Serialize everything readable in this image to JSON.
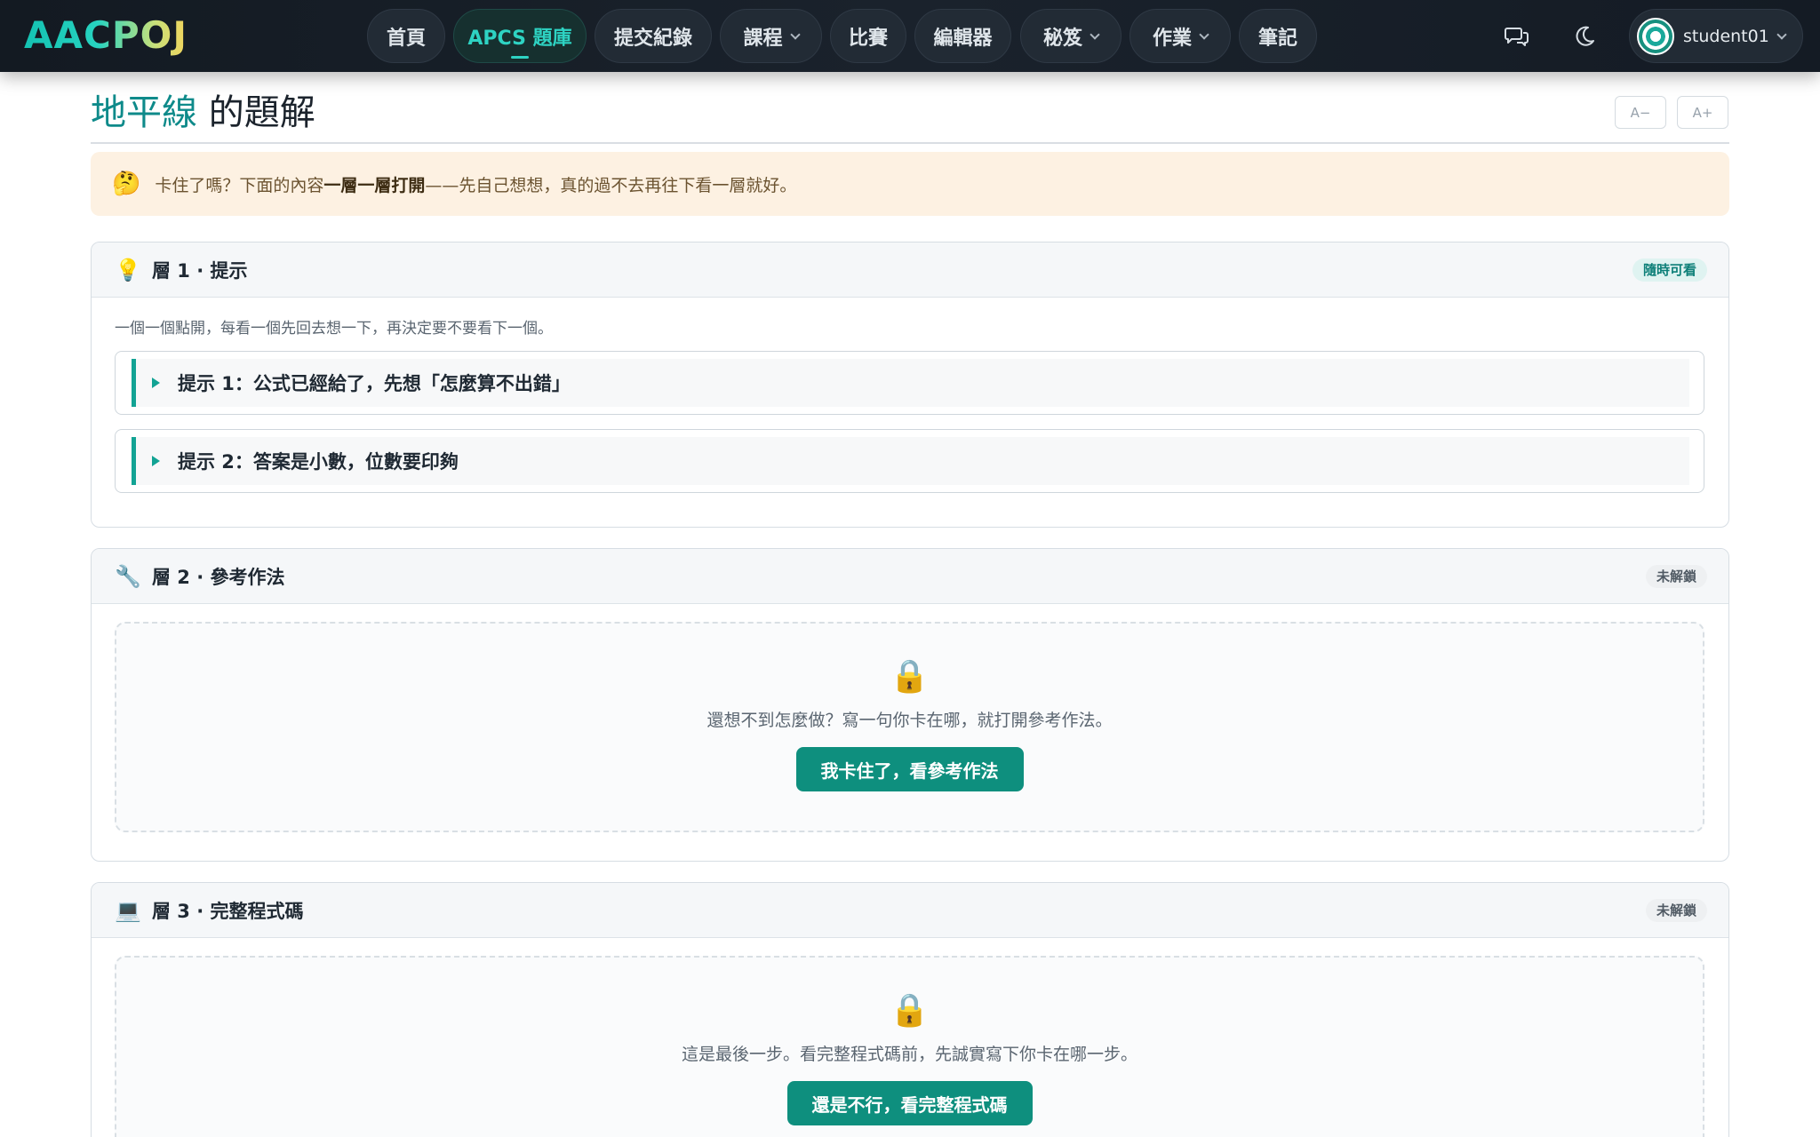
{
  "brand": {
    "logo_text": "AACPOJ"
  },
  "nav": {
    "items": [
      {
        "label": "首頁"
      },
      {
        "label": "APCS 題庫"
      },
      {
        "label": "提交紀錄"
      },
      {
        "label": "課程"
      },
      {
        "label": "比賽"
      },
      {
        "label": "編輯器"
      },
      {
        "label": "秘笈"
      },
      {
        "label": "作業"
      },
      {
        "label": "筆記"
      }
    ],
    "active_item": "APCS 題庫",
    "user": {
      "name": "student01"
    },
    "icons": [
      "chat-icon",
      "moon-icon"
    ]
  },
  "page": {
    "title_problem": "地平線",
    "title_suffix": " 的題解",
    "font_decrease": "A−",
    "font_increase": "A+"
  },
  "notice": {
    "emoji": "🤔",
    "text_before": "卡住了嗎？下面的內容",
    "text_bold": "一層一層打開",
    "text_after": "——先自己想想，真的過不去再往下看一層就好。"
  },
  "layers": [
    {
      "icon": "💡",
      "title": "層 1 · 提示",
      "badge": "隨時可看",
      "intro": "一個一個點開，每看一個先回去想一下，再決定要不要看下一個。",
      "hints": [
        {
          "label": "提示 1：公式已經給了，先想「怎麼算不出錯」"
        },
        {
          "label": "提示 2：答案是小數，位數要印夠"
        }
      ]
    },
    {
      "icon": "🔧",
      "title": "層 2 · 參考作法",
      "badge": "未解鎖",
      "lock_icon": "🔒",
      "lock_text": "還想不到怎麼做？寫一句你卡在哪，就打開參考作法。",
      "button": "我卡住了，看參考作法"
    },
    {
      "icon": "💻",
      "title": "層 3 · 完整程式碼",
      "badge": "未解鎖",
      "lock_icon": "🔒",
      "lock_text": "這是最後一步。看完整程式碼前，先誠實寫下你卡在哪一步。",
      "button": "還是不行，看完整程式碼"
    }
  ],
  "colors": {
    "accent": "#12a394",
    "button": "#0e8f7e",
    "navbar": "#141b24",
    "notice_bg": "#fdf1e2"
  }
}
